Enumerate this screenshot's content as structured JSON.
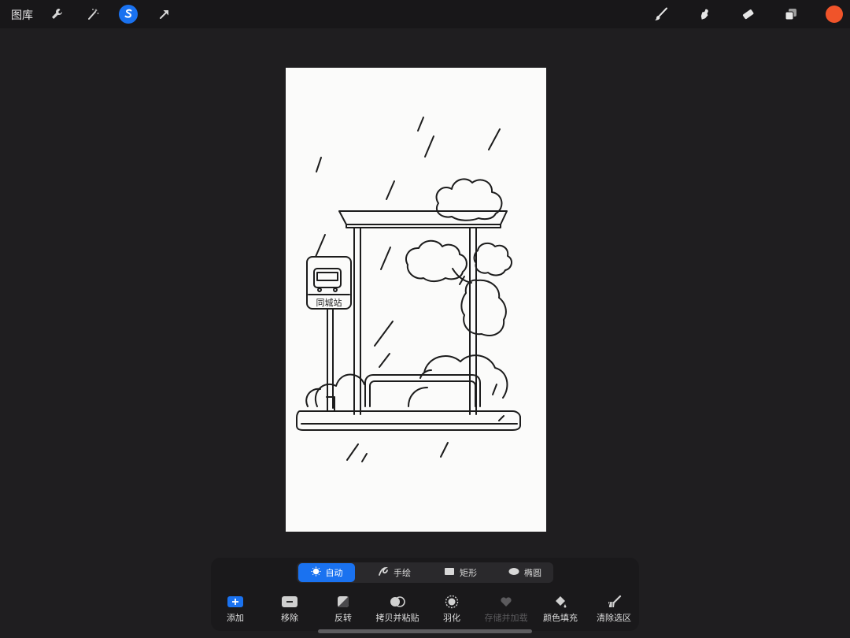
{
  "topbar": {
    "gallery_label": "图库",
    "tools_left": [
      "wrench-icon",
      "magic-wand-icon",
      "selection-icon",
      "transform-arrow-icon"
    ],
    "tools_right": [
      "brush-icon",
      "smudge-icon",
      "eraser-icon",
      "layers-icon"
    ],
    "current_color": "#f0542a",
    "active_tool": "selection-icon"
  },
  "canvas": {
    "sign_text": "同城站"
  },
  "selection_panel": {
    "modes": [
      {
        "label": "自动",
        "icon": "sun-icon",
        "active": true
      },
      {
        "label": "手绘",
        "icon": "freehand-icon",
        "active": false
      },
      {
        "label": "矩形",
        "icon": "rectangle-icon",
        "active": false
      },
      {
        "label": "椭圆",
        "icon": "ellipse-icon",
        "active": false
      }
    ],
    "actions": [
      {
        "label": "添加",
        "icon": "add-icon",
        "enabled": true
      },
      {
        "label": "移除",
        "icon": "remove-icon",
        "enabled": true
      },
      {
        "label": "反转",
        "icon": "invert-icon",
        "enabled": true
      },
      {
        "label": "拷贝并粘贴",
        "icon": "copy-paste-icon",
        "enabled": true
      },
      {
        "label": "羽化",
        "icon": "feather-icon",
        "enabled": true
      },
      {
        "label": "存储并加载",
        "icon": "heart-icon",
        "enabled": false
      },
      {
        "label": "颜色填充",
        "icon": "color-fill-icon",
        "enabled": true
      },
      {
        "label": "清除选区",
        "icon": "clear-selection-icon",
        "enabled": true
      }
    ],
    "accent_color": "#1a72f0"
  }
}
